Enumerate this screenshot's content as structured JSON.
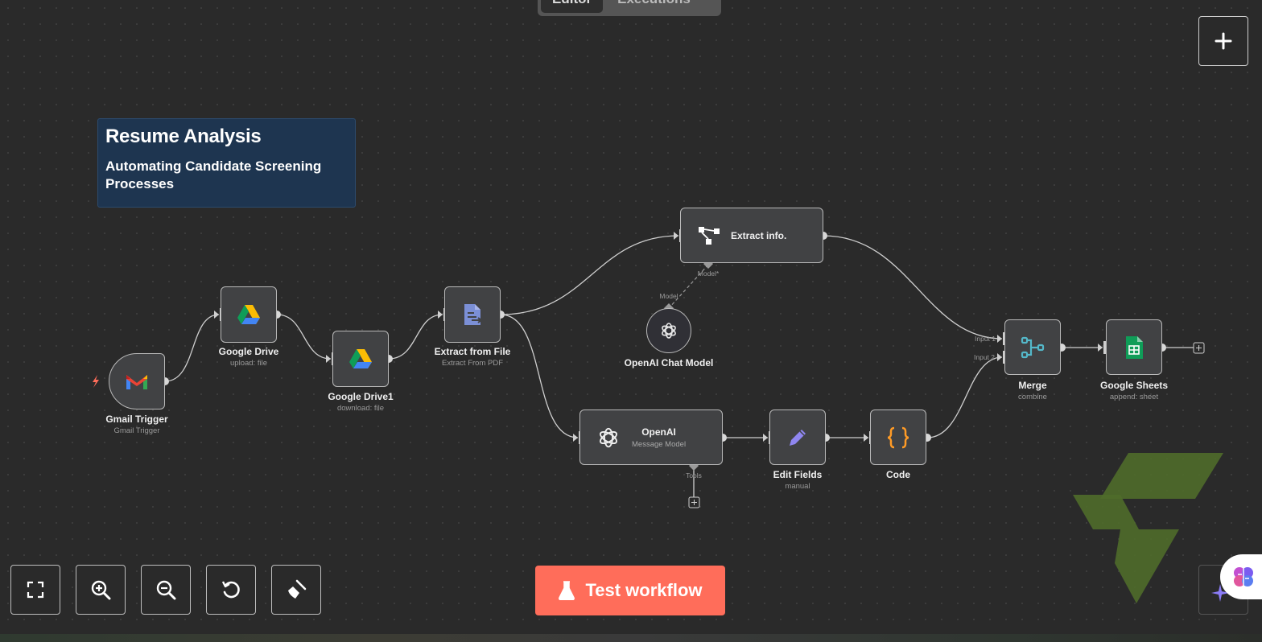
{
  "top_tabs": {
    "editor": "Editor",
    "executions": "Executions"
  },
  "sticky_note": {
    "title": "Resume Analysis",
    "body": "Automating Candidate Screening Processes"
  },
  "nodes": {
    "gmail_trigger": {
      "title": "Gmail Trigger",
      "subtitle": "Gmail Trigger",
      "icon": "gmail-icon"
    },
    "google_drive": {
      "title": "Google Drive",
      "subtitle": "upload: file",
      "icon": "google-drive-icon"
    },
    "google_drive1": {
      "title": "Google Drive1",
      "subtitle": "download: file",
      "icon": "google-drive-icon"
    },
    "extract_from_file": {
      "title": "Extract from File",
      "subtitle": "Extract From PDF",
      "icon": "file-extract-icon"
    },
    "extract_info": {
      "title": "Extract info.",
      "icon": "information-extractor-icon",
      "port_label": "Model*"
    },
    "openai_chat_model": {
      "title": "OpenAI Chat Model",
      "icon": "openai-icon",
      "port_label": "Model"
    },
    "openai": {
      "title": "OpenAI",
      "subtitle": "Message Model",
      "icon": "openai-icon",
      "port_label": "Tools"
    },
    "edit_fields": {
      "title": "Edit Fields",
      "subtitle": "manual",
      "icon": "pencil-icon"
    },
    "code": {
      "title": "Code",
      "icon": "code-braces-icon"
    },
    "merge": {
      "title": "Merge",
      "subtitle": "combine",
      "icon": "merge-icon",
      "input1": "Input 1",
      "input2": "Input 2"
    },
    "google_sheets": {
      "title": "Google Sheets",
      "subtitle": "append: sheet",
      "icon": "google-sheets-icon"
    }
  },
  "controls": {
    "fit_view": "fit-view-icon",
    "zoom_in": "zoom-in-icon",
    "zoom_out": "zoom-out-icon",
    "reset": "undo-icon",
    "tidy": "broom-icon"
  },
  "test_button": {
    "label": "Test workflow",
    "icon": "flask-icon"
  },
  "colors": {
    "accent": "#ff6d5a",
    "canvas": "#2a2a2a",
    "node_bg": "#414244",
    "sticky_bg": "#1e3550"
  }
}
